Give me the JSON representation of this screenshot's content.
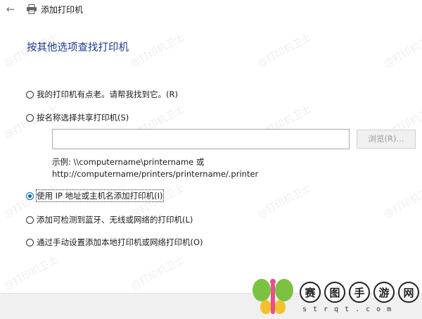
{
  "window": {
    "title": "添加打印机"
  },
  "heading": "按其他选项查找打印机",
  "options": [
    {
      "label": "我的打印机有点老。请帮我找到它。(R)",
      "checked": false
    },
    {
      "label": "按名称选择共享打印机(S)",
      "checked": false
    },
    {
      "label": "使用 IP 地址或主机名添加打印机(I)",
      "checked": true
    },
    {
      "label": "添加可检测到蓝牙、无线或网络的打印机(L)",
      "checked": false
    },
    {
      "label": "通过手动设置添加本地打印机或网络打印机(O)",
      "checked": false
    }
  ],
  "share_input": {
    "value": ""
  },
  "browse_button": "浏览(R)...",
  "example": {
    "line1": "示例: \\\\computername\\printername 或",
    "line2": "http://computername/printers/printername/.printer"
  },
  "watermark": "@打印机卫士",
  "brand": {
    "chars": [
      "赛",
      "图",
      "手",
      "游",
      "网"
    ],
    "url": "strqt.com",
    "colors": {
      "green": "#7cc242",
      "pink": "#e84e8a",
      "yellow": "#f2c12e"
    }
  },
  "colors": {
    "heading": "#1a3c8c",
    "radio_checked": "#0063b1",
    "footer": "#f0f0f0"
  },
  "icons": {
    "back": "back-arrow-icon",
    "printer": "printer-icon"
  }
}
